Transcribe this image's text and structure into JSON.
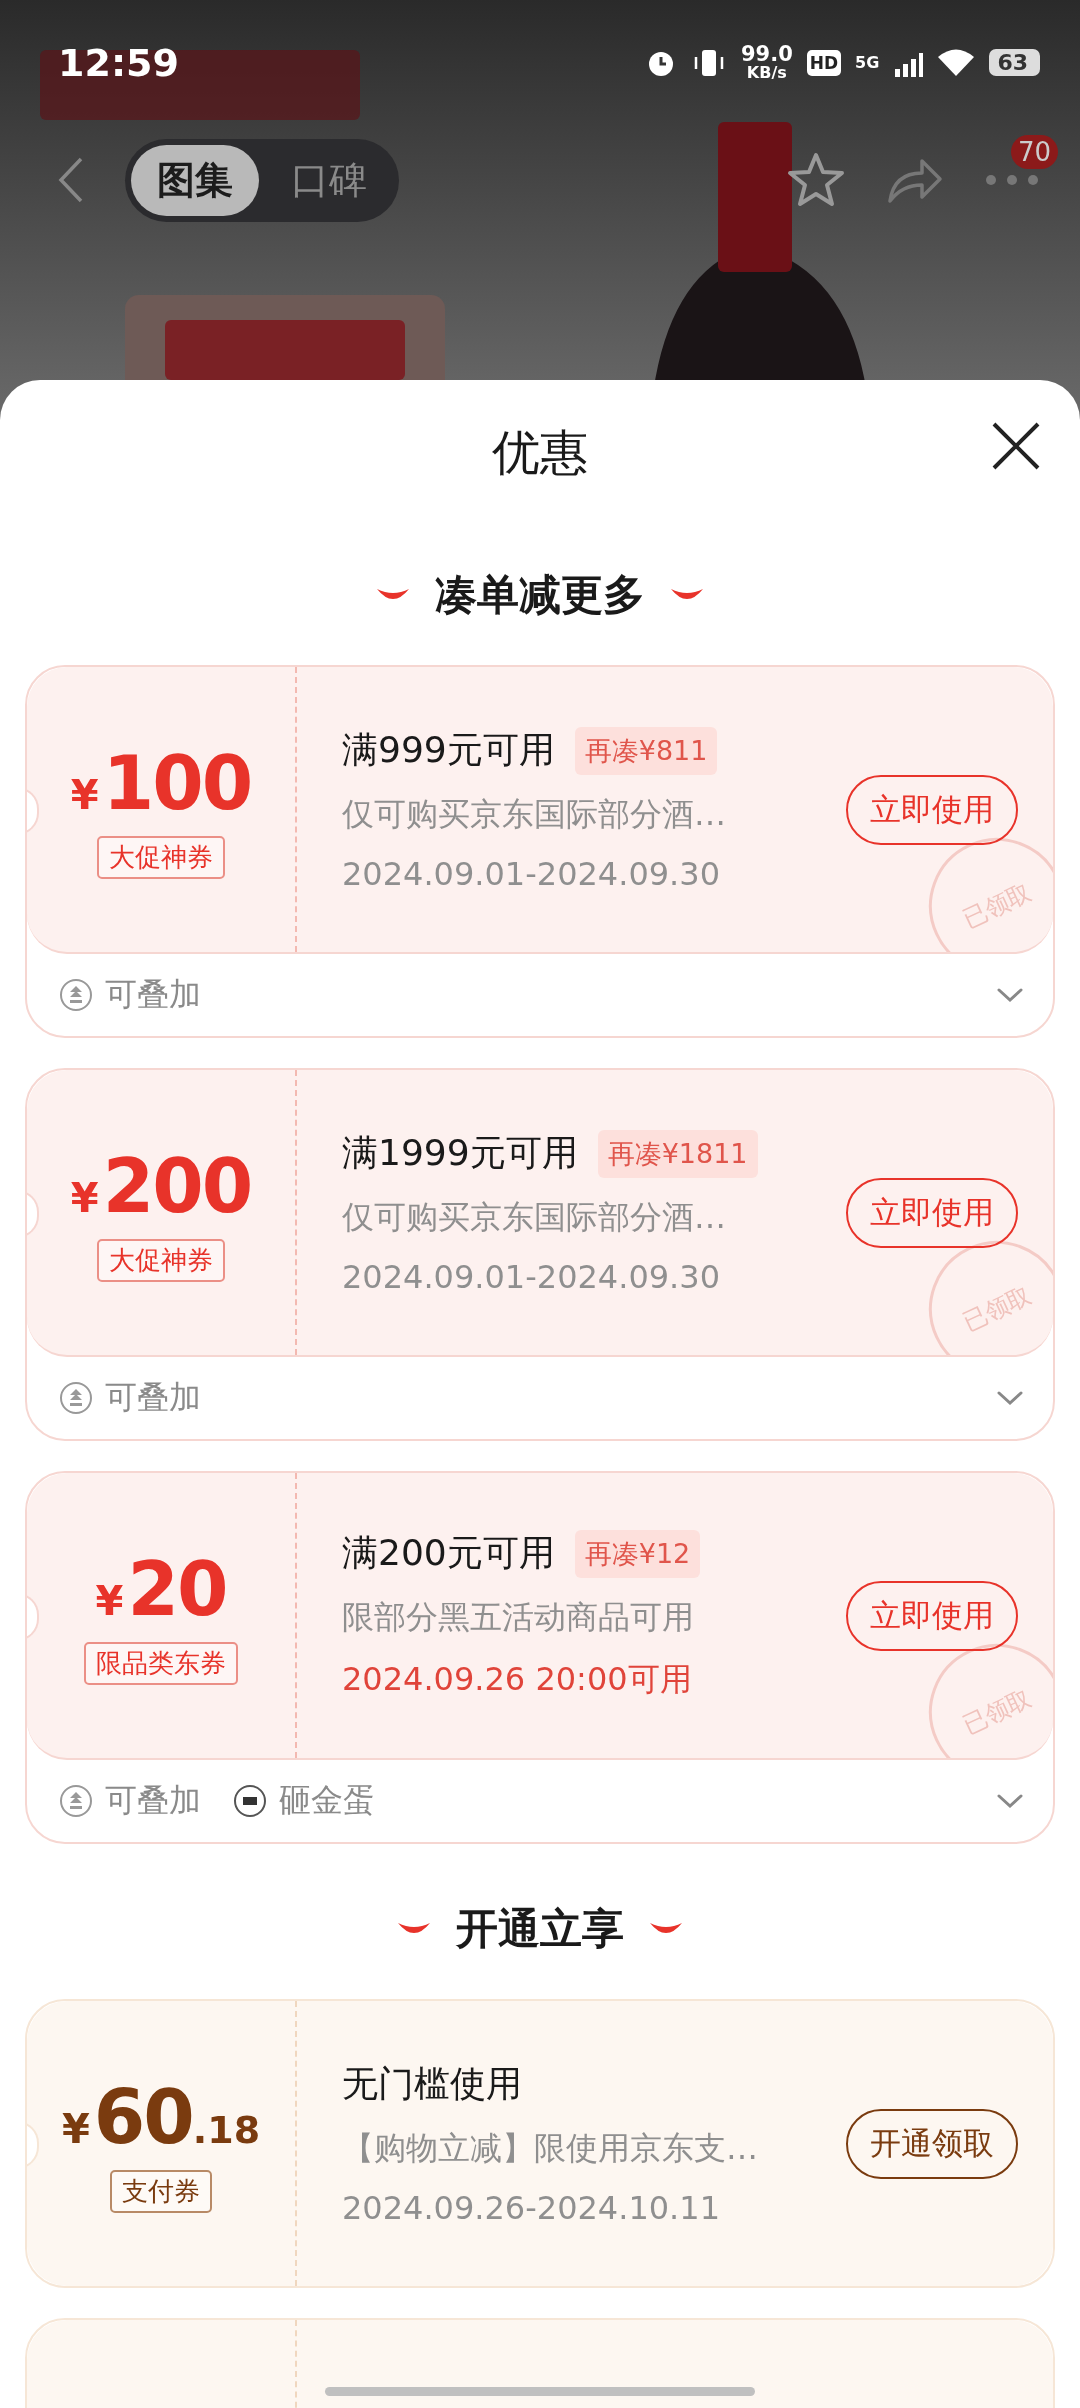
{
  "status_bar": {
    "time": "12:59",
    "net_speed": "99.0",
    "net_unit": "KB/s",
    "hd": "HD",
    "network": "5G",
    "battery": "63"
  },
  "nav": {
    "tabs": [
      {
        "label": "图集",
        "selected": true
      },
      {
        "label": "口碑",
        "selected": false
      }
    ],
    "badge": "70"
  },
  "sheet": {
    "title": "优惠"
  },
  "sections": [
    {
      "title": "凑单减更多",
      "kind": "deal",
      "coupons": [
        {
          "kind": "full",
          "currency": "¥",
          "amount": "100",
          "tag": "大促神券",
          "condition": "满999元可用",
          "gap": "再凑¥811",
          "desc": "仅可购买京东国际部分酒…",
          "date": "2024.09.01-2024.09.30",
          "date_highlight": false,
          "button": "立即使用",
          "stamp": "已领取",
          "footer": [
            {
              "kind": "stack",
              "label": "可叠加"
            }
          ],
          "expanded": false
        },
        {
          "kind": "full",
          "currency": "¥",
          "amount": "200",
          "tag": "大促神券",
          "condition": "满1999元可用",
          "gap": "再凑¥1811",
          "desc": "仅可购买京东国际部分酒…",
          "date": "2024.09.01-2024.09.30",
          "date_highlight": false,
          "button": "立即使用",
          "stamp": "已领取",
          "footer": [
            {
              "kind": "stack",
              "label": "可叠加"
            }
          ],
          "expanded": false
        },
        {
          "kind": "full",
          "currency": "¥",
          "amount": "20",
          "tag": "限品类东券",
          "condition": "满200元可用",
          "gap": "再凑¥12",
          "desc": "限部分黑五活动商品可用",
          "date": "2024.09.26 20:00可用",
          "date_highlight": true,
          "button": "立即使用",
          "stamp": "已领取",
          "footer": [
            {
              "kind": "stack",
              "label": "可叠加"
            },
            {
              "kind": "egg",
              "label": "砸金蛋"
            }
          ],
          "expanded": false
        }
      ]
    },
    {
      "title": "开通立享",
      "kind": "membership",
      "coupons": [
        {
          "kind": "full",
          "currency": "¥",
          "amount": "60",
          "decimal": ".18",
          "tag": "支付券",
          "condition": "无门槛使用",
          "desc": "【购物立减】限使用京东支…",
          "date": "2024.09.26-2024.10.11",
          "date_highlight": false,
          "button": "开通领取"
        },
        {
          "kind": "stub"
        }
      ]
    }
  ]
}
